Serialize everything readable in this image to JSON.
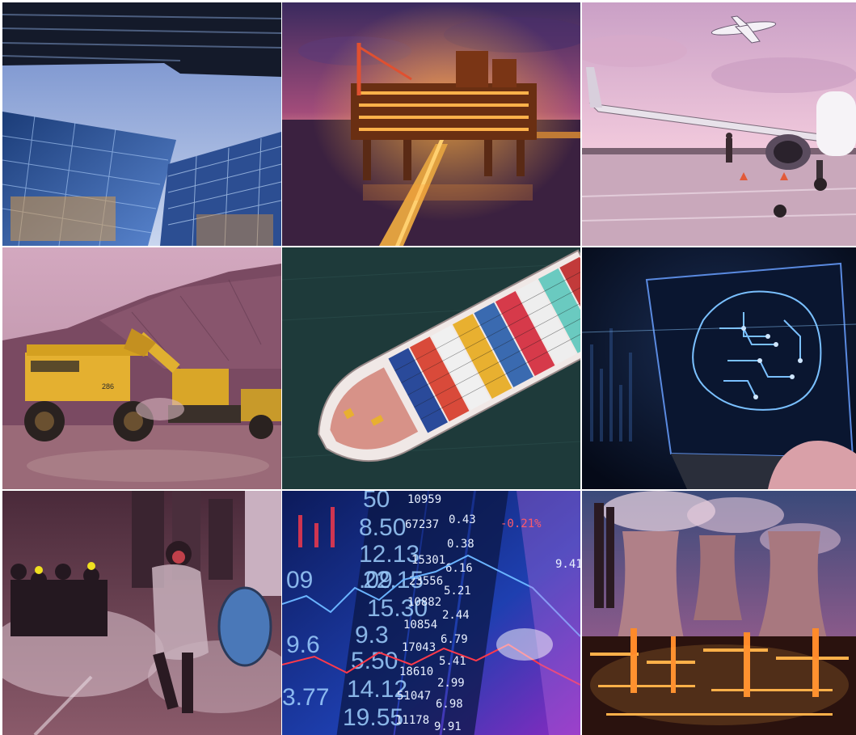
{
  "tiles": [
    {
      "subject": "skyscrapers-looking-up"
    },
    {
      "subject": "offshore-oil-platform-at-dusk"
    },
    {
      "subject": "airplane-on-tarmac"
    },
    {
      "subject": "mining-trucks-and-excavator"
    },
    {
      "subject": "container-ship-aerial"
    },
    {
      "subject": "ai-brain-circuit-laptop"
    },
    {
      "subject": "street-protest-with-tear-gas"
    },
    {
      "subject": "stock-market-ticker-screen"
    },
    {
      "subject": "refinery-cooling-towers-at-night"
    }
  ],
  "truck_number": "286",
  "stock_ticker": {
    "col1": [
      "50",
      "8.50",
      "12.13",
      ".09",
      "22.15",
      "15.30",
      "9.3",
      "5.50",
      "14.12",
      "19.55"
    ],
    "col2": [
      "10959",
      "67237",
      "15301",
      "23556",
      "10882",
      "10854",
      "17043",
      "18610",
      "51047",
      "11178"
    ],
    "col3": [
      "0.43",
      "0.38",
      "6.16",
      "5.21",
      "2.44",
      "6.79",
      "5.41",
      "2.99",
      "6.98",
      "9.91"
    ],
    "big_left": [
      "09",
      "9.6",
      "3.77"
    ],
    "change_red": "-0.21%",
    "change_right": "9.41"
  },
  "colors": {
    "background": "#ffffff",
    "sky_pink": "#e8b9cf",
    "dusk_purple": "#6a2e7a",
    "oil_glow": "#ff9a2a",
    "ocean_teal": "#1b3a3c",
    "circuit_blue": "#58a8ff",
    "ticker_blue": "#1d3fa6",
    "refinery_orange": "#ffb04a"
  }
}
